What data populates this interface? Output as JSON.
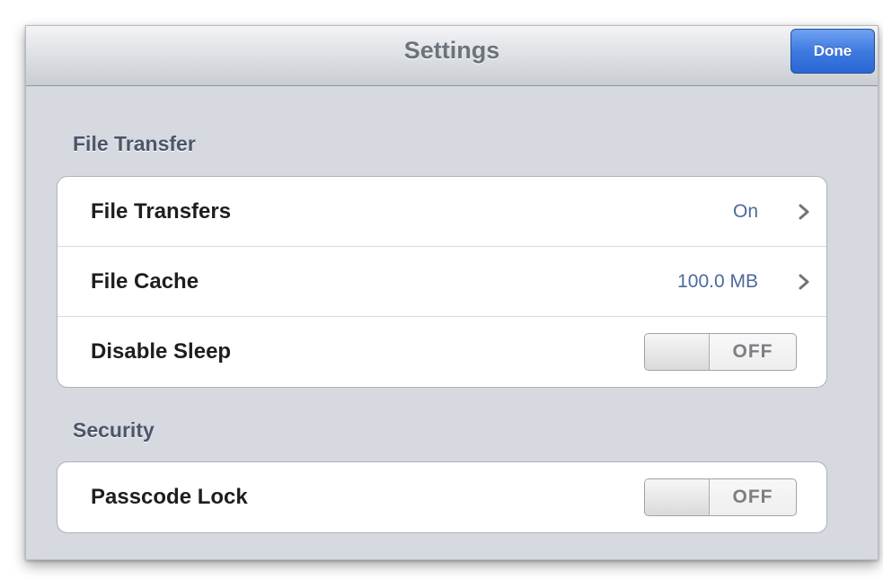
{
  "navbar": {
    "title": "Settings",
    "done_label": "Done"
  },
  "sections": [
    {
      "header": "File Transfer",
      "rows": [
        {
          "label": "File Transfers",
          "value": "On",
          "type": "disclosure",
          "icon": "chevron-right-icon"
        },
        {
          "label": "File Cache",
          "value": "100.0 MB",
          "type": "disclosure",
          "icon": "chevron-right-icon"
        },
        {
          "label": "Disable Sleep",
          "type": "toggle",
          "state": "OFF"
        }
      ]
    },
    {
      "header": "Security",
      "rows": [
        {
          "label": "Passcode Lock",
          "type": "toggle",
          "state": "OFF"
        }
      ]
    }
  ],
  "colors": {
    "accent": "#3f7ae0",
    "detail_text": "#4c6a9b",
    "section_header": "#4c566a",
    "background": "#d6d9df"
  }
}
